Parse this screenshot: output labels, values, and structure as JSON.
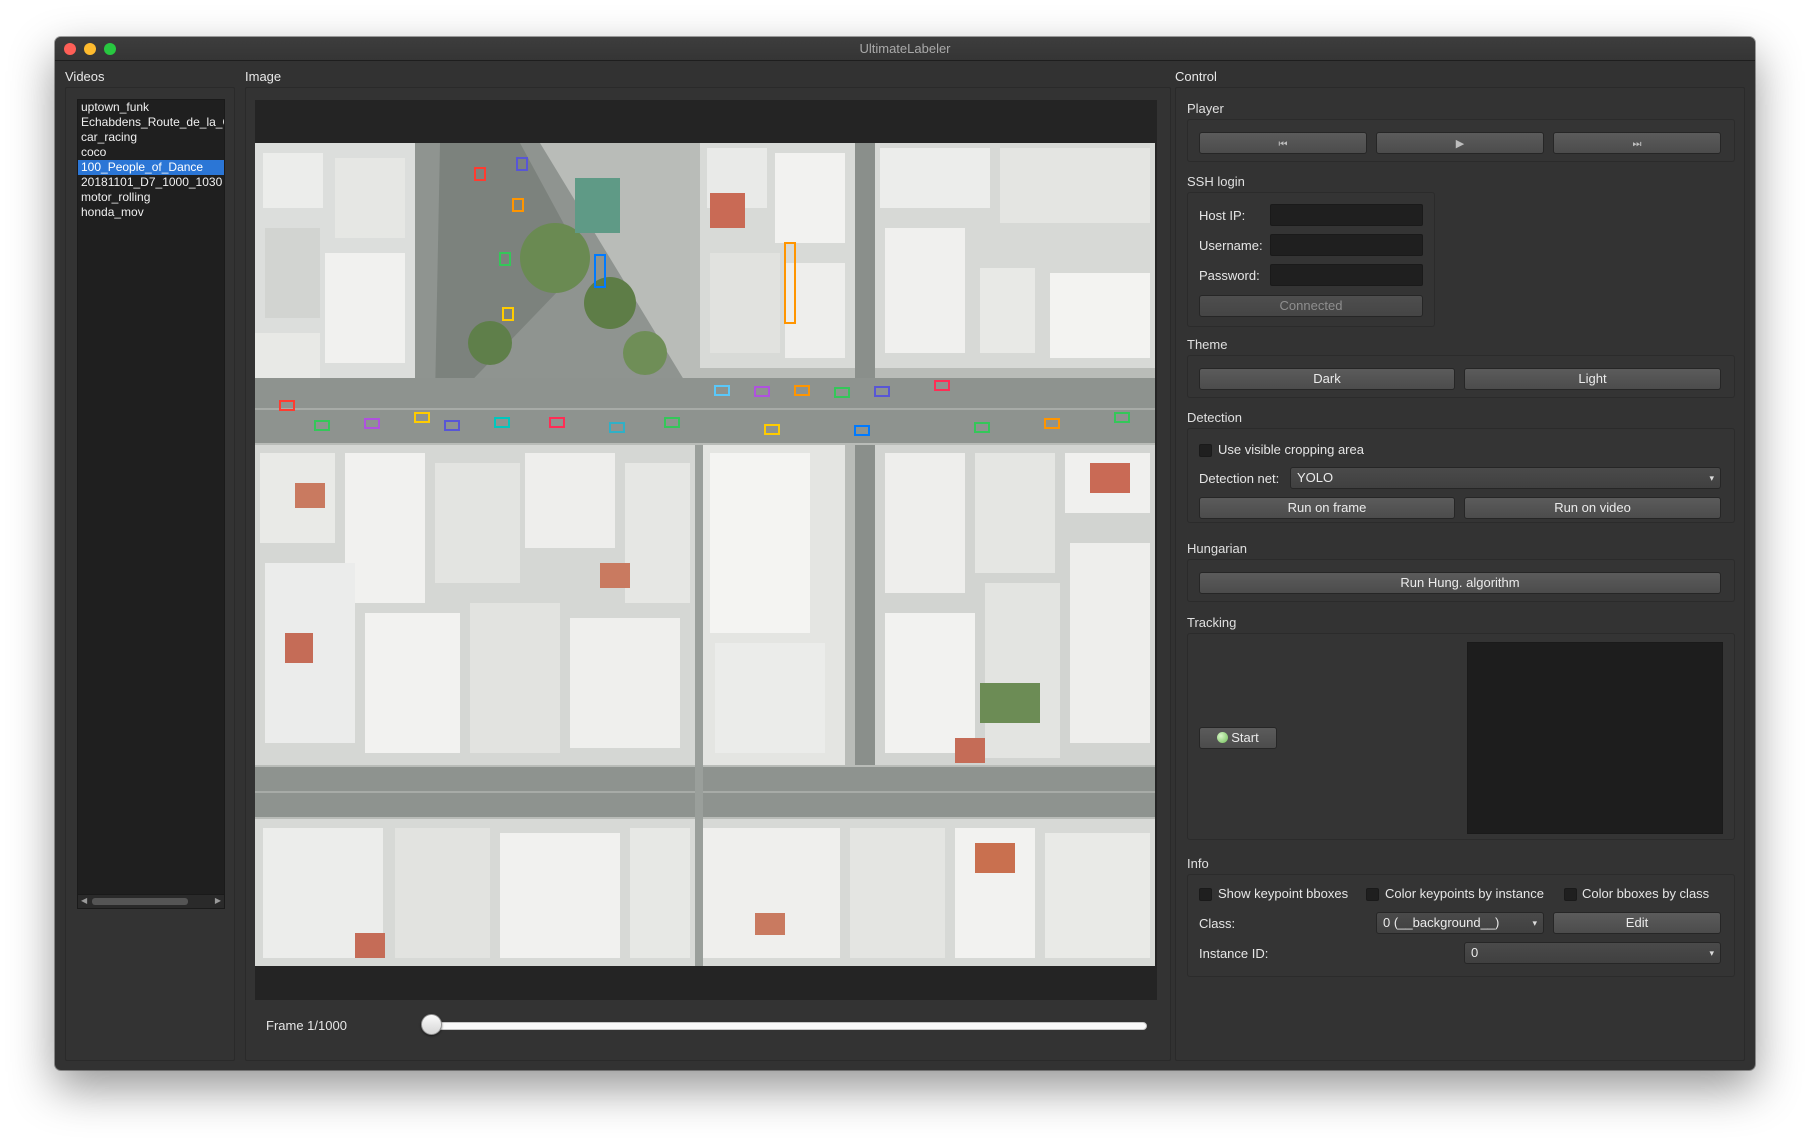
{
  "window": {
    "title": "UltimateLabeler"
  },
  "videos": {
    "label": "Videos",
    "items": [
      "uptown_funk",
      "Echabdens_Route_de_la_C",
      "car_racing",
      "coco",
      "100_People_of_Dance",
      "20181101_D7_1000_1030",
      "motor_rolling",
      "honda_mov"
    ],
    "selected_index": 4
  },
  "image": {
    "label": "Image",
    "frame_label": "Frame 1/1000",
    "frame_value": 1,
    "frame_total": 1000
  },
  "control": {
    "label": "Control",
    "player": {
      "title": "Player",
      "prev_icon": "⏮",
      "play_icon": "▶",
      "next_icon": "⏭"
    },
    "ssh": {
      "title": "SSH login",
      "host_label": "Host IP:",
      "username_label": "Username:",
      "password_label": "Password:",
      "host_value": "",
      "username_value": "",
      "password_value": "",
      "connect_label": "Connected"
    },
    "theme": {
      "title": "Theme",
      "dark_label": "Dark",
      "light_label": "Light"
    },
    "detection": {
      "title": "Detection",
      "cropping_label": "Use visible cropping area",
      "cropping_checked": false,
      "net_label": "Detection net:",
      "net_value": "YOLO",
      "run_frame_label": "Run on frame",
      "run_video_label": "Run on video"
    },
    "hungarian": {
      "title": "Hungarian",
      "run_label": "Run Hung. algorithm"
    },
    "tracking": {
      "title": "Tracking",
      "start_label": "Start",
      "status_color": "#6fbf57"
    },
    "info": {
      "title": "Info",
      "show_keypoint_label": "Show keypoint bboxes",
      "color_keypoints_label": "Color keypoints by instance",
      "color_bboxes_label": "Color bboxes by class",
      "class_label": "Class:",
      "class_value": "0 (__background__)",
      "edit_label": "Edit",
      "instance_label": "Instance ID:",
      "instance_value": "0"
    }
  },
  "colors": {
    "background": "#323232",
    "selection": "#2b76d6",
    "list_bg": "#1f1f1f"
  },
  "icons": {
    "combo_arrow": "▾",
    "scroll_left": "◀",
    "scroll_right": "▶"
  }
}
